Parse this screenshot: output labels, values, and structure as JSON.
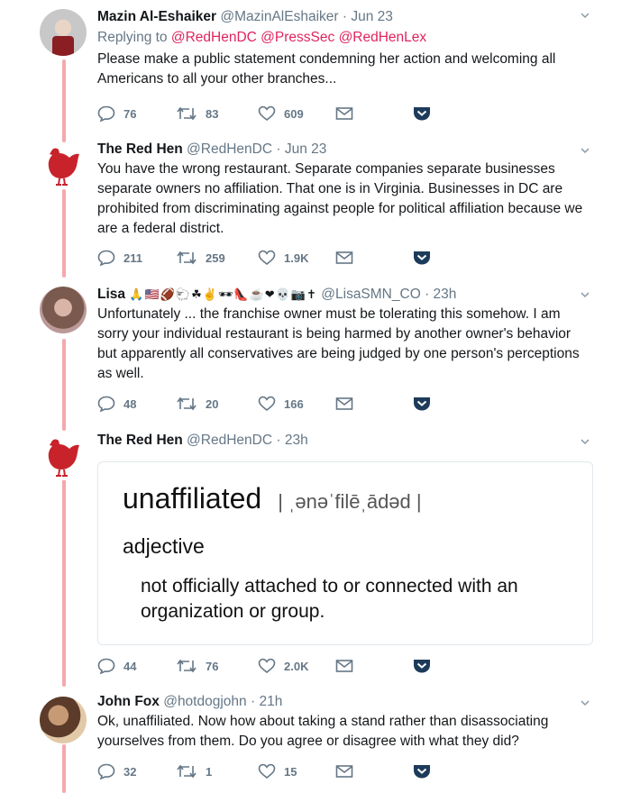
{
  "tweets": [
    {
      "name": "Mazin Al-Eshaiker",
      "handle": "@MazinAlEshaiker",
      "dot": "·",
      "time": "Jun 23",
      "replying_to_label": "Replying to",
      "mentions": [
        "@RedHenDC",
        "@PressSec",
        "@RedHenLex"
      ],
      "text": "Please make a public statement condemning her action and welcoming all Americans to all your other branches...",
      "replies": "76",
      "retweets": "83",
      "likes": "609"
    },
    {
      "name": "The Red Hen",
      "handle": "@RedHenDC",
      "dot": "·",
      "time": "Jun 23",
      "text": "You have the wrong restaurant.  Separate companies separate businesses separate owners no affiliation. That one is in Virginia. Businesses in DC are prohibited from discriminating against people for political affiliation because we are a federal district.",
      "replies": "211",
      "retweets": "259",
      "likes": "1.9K"
    },
    {
      "name": "Lisa",
      "name_emoji": "🙏🇺🇸🏈🐑☘✌🕶👠☕❤💀📷✝",
      "handle": "@LisaSMN_CO",
      "dot": "·",
      "time": "23h",
      "text": "Unfortunately ... the franchise owner must be tolerating this somehow. I am sorry your individual restaurant is being harmed by another owner's behavior but apparently all conservatives are being judged by one person's perceptions as well.",
      "replies": "48",
      "retweets": "20",
      "likes": "166"
    },
    {
      "name": "The Red Hen",
      "handle": "@RedHenDC",
      "dot": "·",
      "time": "23h",
      "card": {
        "word": "unaffiliated",
        "pronunciation": "| ˌənəˈfilēˌādəd |",
        "part_of_speech": "adjective",
        "definition": "not officially attached to or connected with an organization or group."
      },
      "replies": "44",
      "retweets": "76",
      "likes": "2.0K"
    },
    {
      "name": "John Fox",
      "handle": "@hotdogjohn",
      "dot": "·",
      "time": "21h",
      "text": "Ok, unaffiliated. Now how about taking a stand rather than disassociating yourselves from them. Do you agree or disagree with what they did?",
      "replies": "32",
      "retweets": "1",
      "likes": "15"
    }
  ],
  "icons": {
    "reply": "reply-icon",
    "retweet": "retweet-icon",
    "like": "heart-icon",
    "dm": "envelope-icon",
    "bookmark": "pocket-icon",
    "more": "chevron-down-icon"
  },
  "colors": {
    "thread_line": "#f5a8ad",
    "mention": "#e0245e",
    "muted": "#657786",
    "hen_red": "#c8232b",
    "pocket_blue": "#1d3b5a"
  }
}
